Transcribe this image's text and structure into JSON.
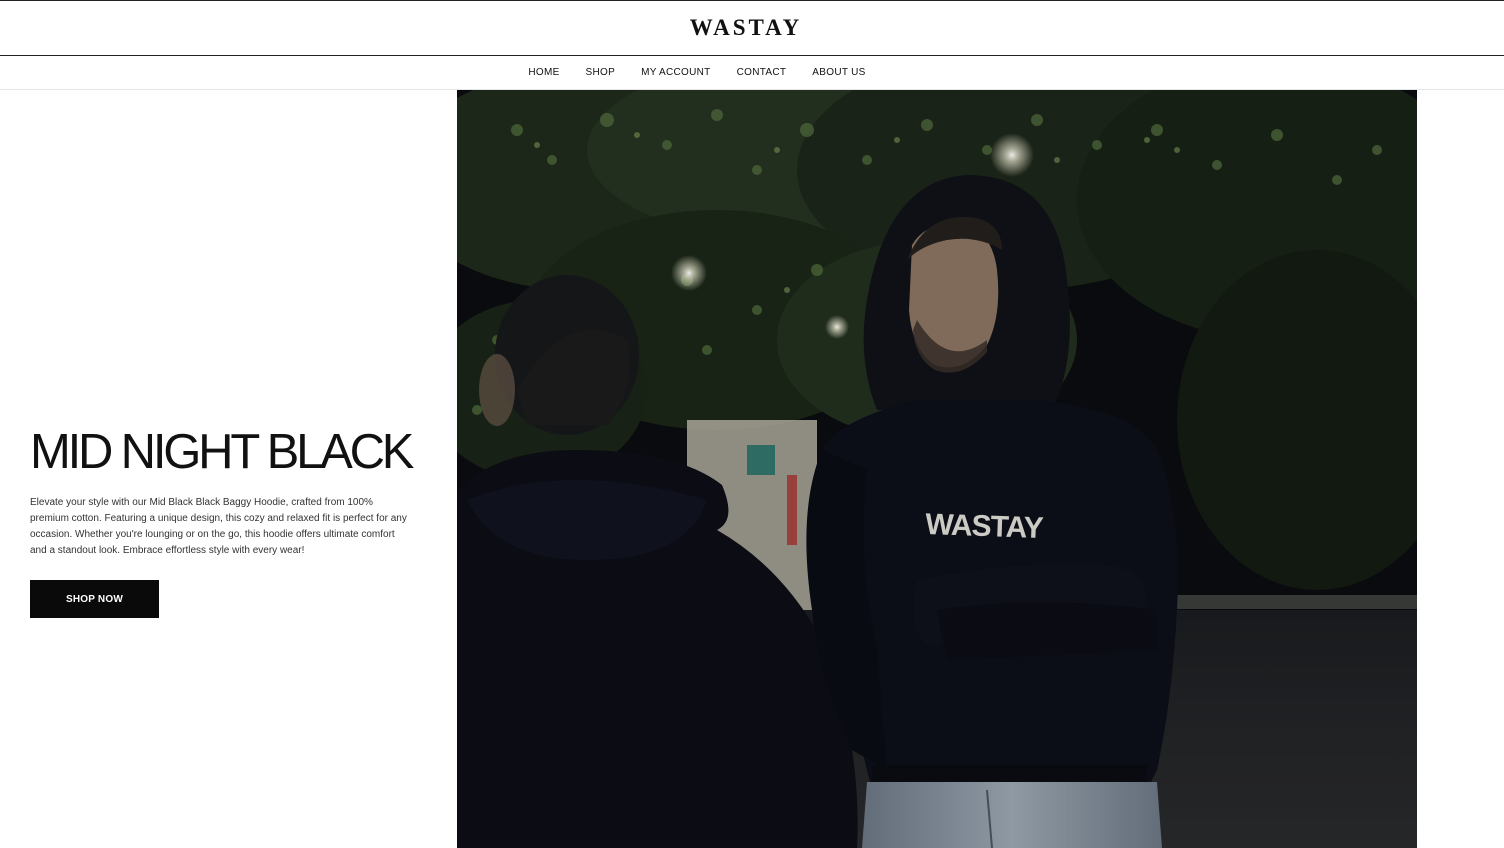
{
  "brand": {
    "name": "WASTAY"
  },
  "nav": {
    "items": [
      {
        "label": "HOME"
      },
      {
        "label": "SHOP"
      },
      {
        "label": "MY ACCOUNT"
      },
      {
        "label": "CONTACT"
      },
      {
        "label": "ABOUT US"
      }
    ]
  },
  "hero": {
    "title": "MID NIGHT BLACK",
    "description": "Elevate your style with our Mid Black Black Baggy Hoodie, crafted from 100% premium cotton. Featuring a unique design, this cozy and relaxed fit is perfect for any occasion. Whether you're lounging or on the go, this hoodie offers ultimate comfort and a standout look. Embrace effortless style with every wear!",
    "cta_label": "SHOP NOW",
    "image": {
      "print_text": "WASTAY",
      "colors": {
        "hoodie": "#0c0e16",
        "foliage": "#2b3a26",
        "night_sky": "#0b0d10",
        "jeans": "#8e9aa8"
      }
    }
  }
}
